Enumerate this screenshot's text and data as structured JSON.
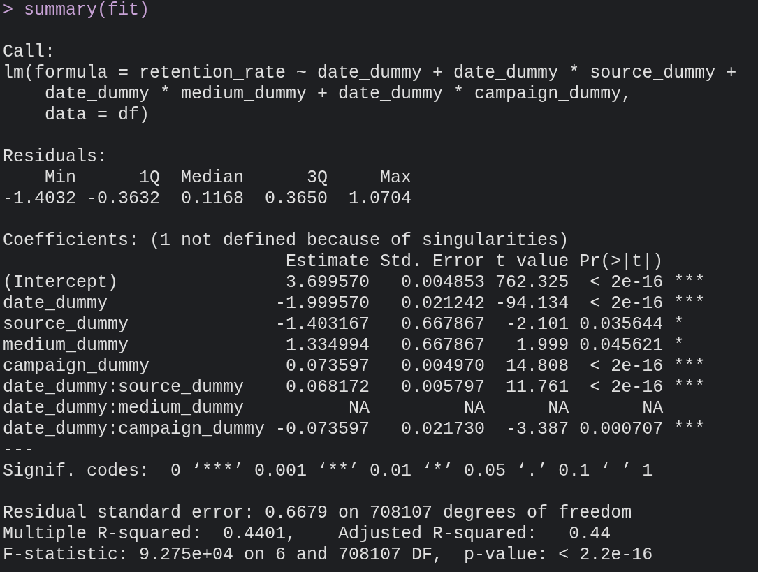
{
  "console": {
    "lines": [
      {
        "kind": "input",
        "prompt": ">",
        "text": "summary(fit)"
      },
      {
        "kind": "blank"
      },
      {
        "kind": "output",
        "text": "Call:"
      },
      {
        "kind": "output",
        "text": "lm(formula = retention_rate ~ date_dummy + date_dummy * source_dummy +"
      },
      {
        "kind": "output",
        "text": "    date_dummy * medium_dummy + date_dummy * campaign_dummy,"
      },
      {
        "kind": "output",
        "text": "    data = df)"
      },
      {
        "kind": "blank"
      },
      {
        "kind": "output",
        "text": "Residuals:"
      },
      {
        "kind": "output",
        "text": "    Min      1Q  Median      3Q     Max "
      },
      {
        "kind": "output",
        "text": "-1.4032 -0.3632  0.1168  0.3650  1.0704 "
      },
      {
        "kind": "blank"
      },
      {
        "kind": "output",
        "text": "Coefficients: (1 not defined because of singularities)"
      },
      {
        "kind": "output",
        "text": "                           Estimate Std. Error t value Pr(>|t|)    "
      },
      {
        "kind": "output",
        "text": "(Intercept)                3.699570   0.004853 762.325  < 2e-16 ***"
      },
      {
        "kind": "output",
        "text": "date_dummy                -1.999570   0.021242 -94.134  < 2e-16 ***"
      },
      {
        "kind": "output",
        "text": "source_dummy              -1.403167   0.667867  -2.101 0.035644 *  "
      },
      {
        "kind": "output",
        "text": "medium_dummy               1.334994   0.667867   1.999 0.045621 *  "
      },
      {
        "kind": "output",
        "text": "campaign_dummy             0.073597   0.004970  14.808  < 2e-16 ***"
      },
      {
        "kind": "output",
        "text": "date_dummy:source_dummy    0.068172   0.005797  11.761  < 2e-16 ***"
      },
      {
        "kind": "output",
        "text": "date_dummy:medium_dummy          NA         NA      NA       NA    "
      },
      {
        "kind": "output",
        "text": "date_dummy:campaign_dummy -0.073597   0.021730  -3.387 0.000707 ***"
      },
      {
        "kind": "output",
        "text": "---"
      },
      {
        "kind": "output",
        "text": "Signif. codes:  0 ‘***’ 0.001 ‘**’ 0.01 ‘*’ 0.05 ‘.’ 0.1 ‘ ’ 1"
      },
      {
        "kind": "blank"
      },
      {
        "kind": "output",
        "text": "Residual standard error: 0.6679 on 708107 degrees of freedom"
      },
      {
        "kind": "output",
        "text": "Multiple R-squared:  0.4401,\tAdjusted R-squared:   0.44 "
      },
      {
        "kind": "output",
        "text": "F-statistic: 9.275e+04 on 6 and 708107 DF,  p-value: < 2.2e-16"
      }
    ]
  }
}
